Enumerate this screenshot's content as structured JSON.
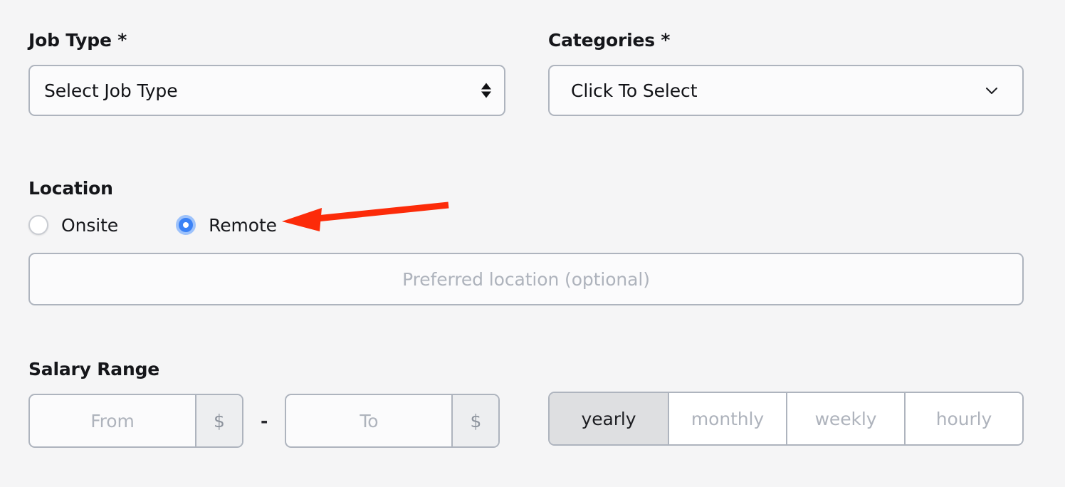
{
  "form": {
    "job_type": {
      "label": "Job Type *",
      "selected_value": "Select Job Type",
      "spinner_icon": "select-spinner-icon"
    },
    "categories": {
      "label": "Categories *",
      "selected_value": "Click To Select",
      "chevron_icon": "chevron-down-icon"
    },
    "location": {
      "label": "Location",
      "options": [
        {
          "label": "Onsite",
          "checked": false
        },
        {
          "label": "Remote",
          "checked": true
        }
      ],
      "preferred_placeholder": "Preferred location (optional)",
      "preferred_value": ""
    },
    "salary": {
      "label": "Salary Range",
      "from_placeholder": "From",
      "from_value": "",
      "to_placeholder": "To",
      "to_value": "",
      "currency_symbol": "$",
      "separator": "-",
      "periods": [
        {
          "label": "yearly",
          "selected": true
        },
        {
          "label": "monthly",
          "selected": false
        },
        {
          "label": "weekly",
          "selected": false
        },
        {
          "label": "hourly",
          "selected": false
        }
      ]
    }
  },
  "annotation": {
    "arrow_color": "#fc2b09",
    "points_to": "Remote"
  },
  "colors": {
    "page_background": "#f5f5f6",
    "border": "#aeb4be",
    "radio_accent": "#3b82f6",
    "radio_halo": "#9dc2fb",
    "placeholder_text": "#aeb3bc",
    "segment_active_bg": "#dedfe1",
    "addon_bg": "#edeef0"
  }
}
